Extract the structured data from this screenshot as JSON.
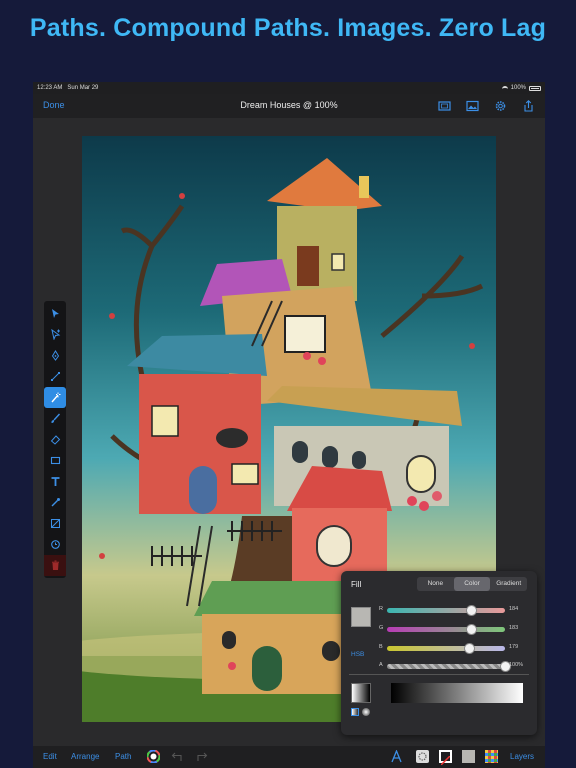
{
  "headline": "Paths. Compound Paths. Images. Zero Lag",
  "status_bar": {
    "time": "12:23 AM",
    "date": "Sun Mar 29",
    "battery": "100%"
  },
  "nav": {
    "done_label": "Done",
    "title": "Dream Houses @ 100%",
    "icons": [
      "canvas-size-icon",
      "image-icon",
      "gear-icon",
      "share-icon"
    ]
  },
  "tools": [
    "select-icon",
    "direct-select-icon",
    "pen-icon",
    "anchor-point-icon",
    "magic-wand-icon",
    "brush-icon",
    "eraser-icon",
    "rectangle-icon",
    "text-icon",
    "eyedropper-icon",
    "gradient-icon",
    "rotate-icon",
    "trash-icon"
  ],
  "fill_panel": {
    "title": "Fill",
    "modes": [
      "None",
      "Color",
      "Gradient"
    ],
    "selected_mode": "Color",
    "swatch_color": "#b8b7b3",
    "channels": [
      {
        "label": "R",
        "value": "184",
        "fraction": 0.72
      },
      {
        "label": "G",
        "value": "183",
        "fraction": 0.72
      },
      {
        "label": "B",
        "value": "179",
        "fraction": 0.7
      },
      {
        "label": "A",
        "value": "100%",
        "fraction": 1.0
      }
    ],
    "hsb_label": "HSB"
  },
  "bottom_bar": {
    "edit": "Edit",
    "arrange": "Arrange",
    "path": "Path",
    "layers": "Layers"
  },
  "colors": {
    "accent": "#3c8fe6",
    "headline": "#3fb8f5"
  }
}
